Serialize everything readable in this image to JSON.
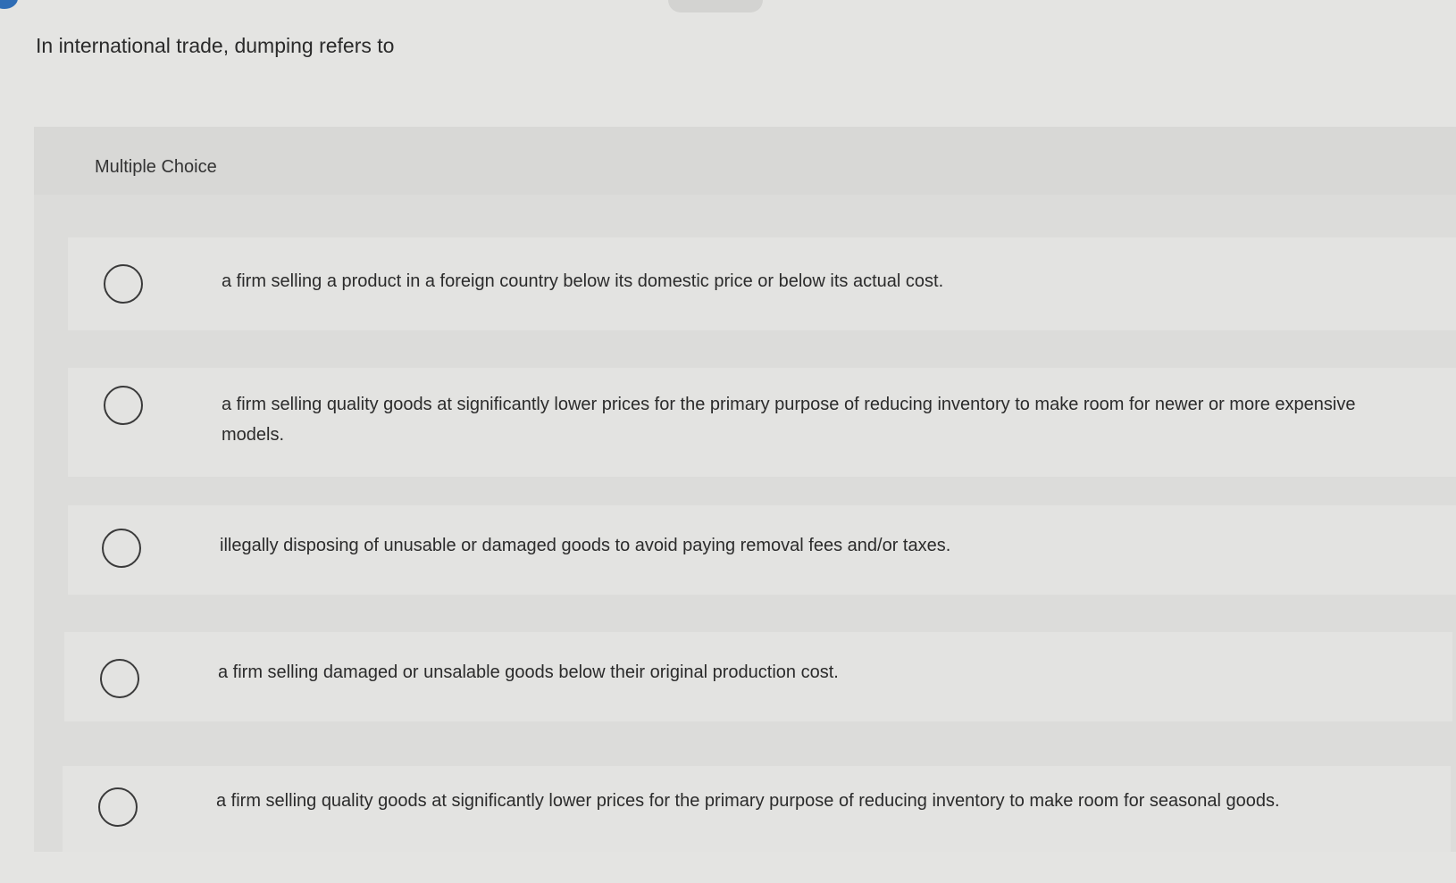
{
  "question": {
    "text": "In international trade, dumping refers to"
  },
  "multiple_choice": {
    "label": "Multiple Choice",
    "options": [
      {
        "text": "a firm selling a product in a foreign country below its domestic price or below its actual cost."
      },
      {
        "text": "a firm selling quality goods at significantly lower prices for the primary purpose of reducing inventory to make room for newer or more expensive models."
      },
      {
        "text": "illegally disposing of unusable or damaged goods to avoid paying removal fees and/or taxes."
      },
      {
        "text": "a firm selling damaged or unsalable goods below their original production cost."
      },
      {
        "text": "a firm selling quality goods at significantly lower prices for the primary purpose of reducing inventory to make room for seasonal goods."
      }
    ]
  },
  "colors": {
    "background": "#e4e4e2",
    "panel": "#dcdcda",
    "text": "#2b2b2b"
  }
}
